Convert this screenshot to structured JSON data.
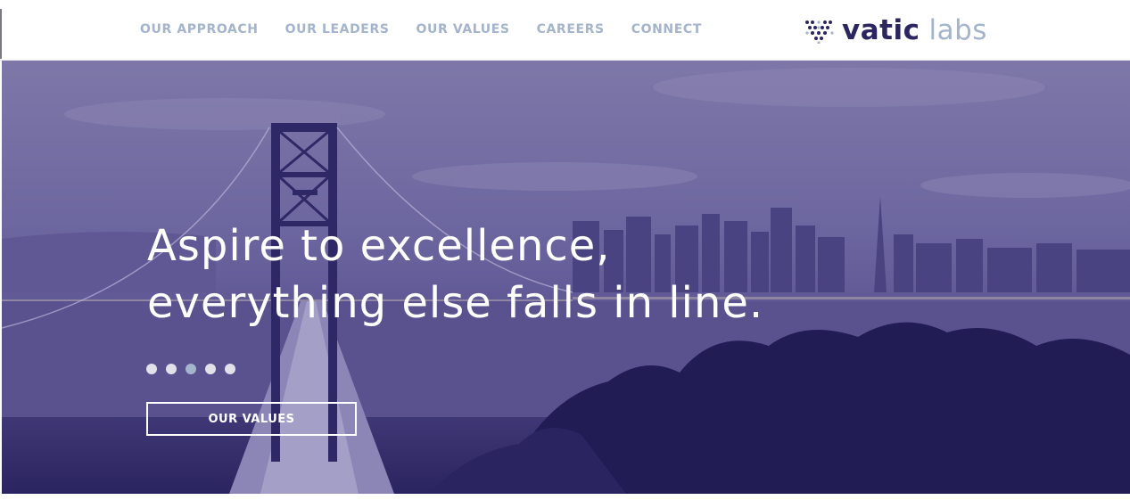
{
  "nav": {
    "items": [
      {
        "label": "OUR APPROACH"
      },
      {
        "label": "OUR LEADERS"
      },
      {
        "label": "OUR VALUES"
      },
      {
        "label": "CAREERS"
      },
      {
        "label": "CONNECT"
      }
    ]
  },
  "logo": {
    "word1": "vatic",
    "word2": "labs",
    "icon": "dot-grid-logo-icon"
  },
  "hero": {
    "headline_line1": "Aspire to excellence,",
    "headline_line2": "everything else falls in line.",
    "slides": {
      "count": 5,
      "active_index": 2
    },
    "cta_label": "OUR VALUES",
    "background": "san-francisco-bay-bridge-photo"
  },
  "colors": {
    "nav_text": "#a3b4cc",
    "brand_dark": "#2b2560",
    "overlay_purple": "#6d67a0",
    "dot_active": "#a3b4cc"
  }
}
